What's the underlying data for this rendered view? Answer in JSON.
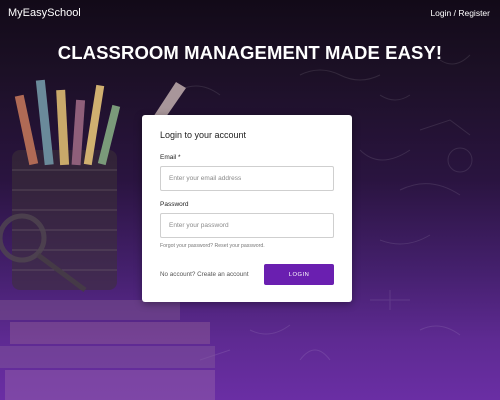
{
  "nav": {
    "brand": "MyEasySchool",
    "login_register": "Login / Register"
  },
  "hero": {
    "title": "CLASSROOM MANAGEMENT MADE EASY!"
  },
  "login_card": {
    "title": "Login to your account",
    "email_label": "Email *",
    "email_placeholder": "Enter your email address",
    "password_label": "Password",
    "password_placeholder": "Enter your password",
    "forgot_text": "Forgot your password? Reset your password.",
    "no_account_text": "No account? Create an account",
    "login_button": "LOGIN"
  },
  "colors": {
    "accent": "#6a1fb0",
    "background_top": "#120a18",
    "background_bottom": "#6a2ea4"
  }
}
